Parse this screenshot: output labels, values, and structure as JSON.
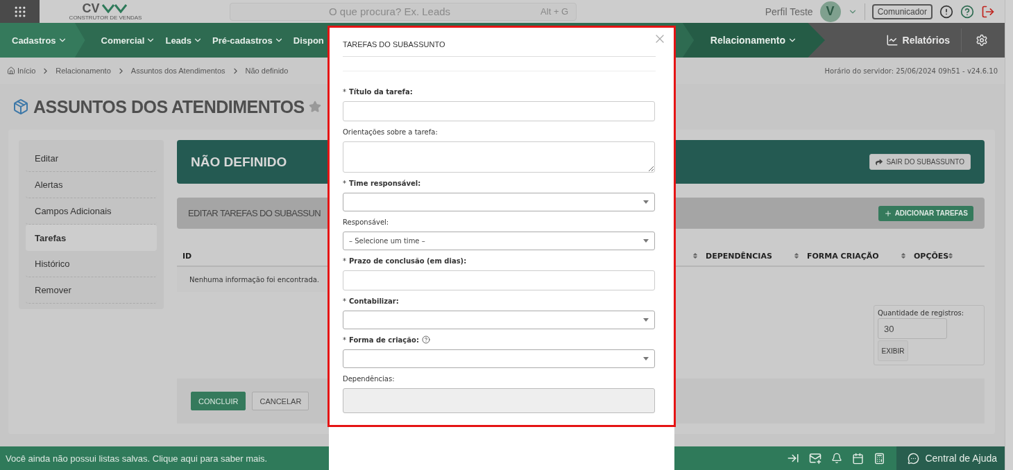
{
  "header": {
    "logo_text": "CV",
    "logo_tagline": "CONSTRUTOR DE VENDAS",
    "search_placeholder": "O que procura? Ex. Leads",
    "search_shortcut": "Alt + G",
    "profile_name": "Perfil Teste",
    "avatar_initial": "V",
    "communicator_button": "Comunicador"
  },
  "nav": {
    "items": [
      {
        "label": "Cadastros",
        "selected": true
      },
      {
        "label": "Comercial",
        "selected": false
      },
      {
        "label": "Leads",
        "selected": false
      },
      {
        "label": "Pré-cadastros",
        "selected": false
      },
      {
        "label": "Dispon",
        "selected": false
      }
    ],
    "section_item": "Relacionamento",
    "reports": "Relatórios"
  },
  "breadcrumbs": [
    "Início",
    "Relacionamento",
    "Assuntos dos Atendimentos",
    "Não definido"
  ],
  "server_time": "Horário do servidor: 25/06/2024 09h51 - v24.6.10",
  "page_title": "ASSUNTOS DOS ATENDIMENTOS",
  "sidebar": {
    "items": [
      {
        "label": "Editar",
        "selected": false
      },
      {
        "label": "Alertas",
        "selected": false
      },
      {
        "label": "Campos Adicionais",
        "selected": false
      },
      {
        "label": "Tarefas",
        "selected": true
      },
      {
        "label": "Histórico",
        "selected": false
      },
      {
        "label": "Remover",
        "selected": false
      }
    ]
  },
  "subject_card": {
    "title": "NÃO DEFINIDO",
    "exit_button": "SAIR DO SUBASSUNTO"
  },
  "tasks_bar": {
    "title": "EDITAR TAREFAS DO SUBASSUN",
    "add_button": "ADICIONAR TAREFAS"
  },
  "table": {
    "columns": [
      {
        "label": "ID",
        "sort_before": false,
        "sort_after": false
      },
      {
        "label": "DEPENDÊNCIAS",
        "sort_before": true,
        "sort_after": false
      },
      {
        "label": "FORMA CRIAÇÃO",
        "sort_before": true,
        "sort_after": false
      },
      {
        "label": "OPÇÕES",
        "sort_before": true,
        "sort_after": true
      }
    ],
    "empty_message": "Nenhuma informação foi encontrada."
  },
  "records": {
    "label": "Quantidade de registros:",
    "value": "30",
    "button": "EXIBIR"
  },
  "actions": [
    "CONCLUIR",
    "CANCELAR"
  ],
  "footer": {
    "message": "Você ainda não possui listas salvas. Clique aqui para saber mais.",
    "help": "Central de Ajuda"
  },
  "dialog": {
    "title": "TAREFAS DO SUBASSUNTO",
    "fields": [
      {
        "kind": "text",
        "required_mark": "*",
        "label": "Título da tarefa:",
        "help": false
      },
      {
        "kind": "textarea",
        "label": "Orientações sobre a tarefa:",
        "help": false
      },
      {
        "kind": "select",
        "required_mark": "*",
        "label": "Time responsável:",
        "help": false
      },
      {
        "kind": "select",
        "label": "Responsável:",
        "value": "– Selecione um time –",
        "help": false
      },
      {
        "kind": "text",
        "required_mark": "*",
        "label": "Prazo de conclusão (em dias):",
        "help": false
      },
      {
        "kind": "select",
        "required_mark": "*",
        "label": "Contabilizar:",
        "help": false
      },
      {
        "kind": "select",
        "required_mark": "*",
        "label": "Forma de criação:",
        "help": true
      },
      {
        "kind": "disabled",
        "label": "Dependências:",
        "help": false
      }
    ]
  }
}
